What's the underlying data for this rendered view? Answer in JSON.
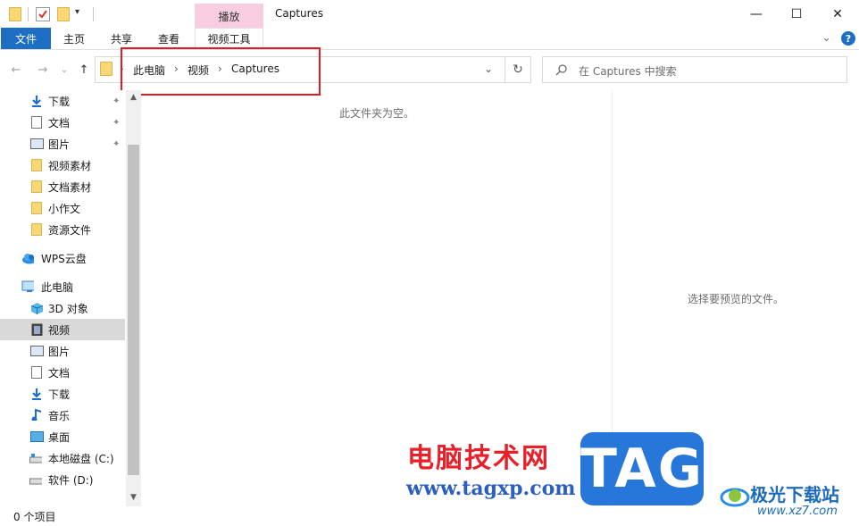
{
  "window": {
    "title": "Captures",
    "contextual_group": "播放",
    "controls": {
      "minimize": "—",
      "maximize": "☐",
      "close": "✕"
    }
  },
  "ribbon": {
    "tabs": [
      {
        "label": "文件"
      },
      {
        "label": "主页"
      },
      {
        "label": "共享"
      },
      {
        "label": "查看"
      },
      {
        "label": "视频工具"
      }
    ],
    "collapse_glyph": "⌄",
    "help_glyph": "?"
  },
  "navigation": {
    "back": "←",
    "forward": "→",
    "recent": "⌄",
    "up": "↑",
    "breadcrumbs": [
      "此电脑",
      "视频",
      "Captures"
    ],
    "dropdown": "⌄",
    "refresh": "↻",
    "search_placeholder": "在 Captures 中搜索"
  },
  "sidebar": {
    "quick_access": [
      {
        "label": "下载",
        "icon": "download-icon",
        "pinned": true
      },
      {
        "label": "文档",
        "icon": "document-icon",
        "pinned": true
      },
      {
        "label": "图片",
        "icon": "picture-icon",
        "pinned": true
      },
      {
        "label": "视频素材",
        "icon": "folder-icon",
        "pinned": false
      },
      {
        "label": "文档素材",
        "icon": "folder-icon",
        "pinned": false
      },
      {
        "label": "小作文",
        "icon": "folder-icon",
        "pinned": false
      },
      {
        "label": "资源文件",
        "icon": "folder-icon",
        "pinned": false
      }
    ],
    "wps": {
      "label": "WPS云盘",
      "icon": "cloud-icon"
    },
    "this_pc": {
      "label": "此电脑",
      "icon": "computer-icon"
    },
    "pc_items": [
      {
        "label": "3D 对象",
        "icon": "cube-icon"
      },
      {
        "label": "视频",
        "icon": "video-icon",
        "selected": true
      },
      {
        "label": "图片",
        "icon": "picture-icon"
      },
      {
        "label": "文档",
        "icon": "document-icon"
      },
      {
        "label": "下载",
        "icon": "download-icon"
      },
      {
        "label": "音乐",
        "icon": "music-icon"
      },
      {
        "label": "桌面",
        "icon": "desktop-icon"
      },
      {
        "label": "本地磁盘 (C:)",
        "icon": "drive-icon"
      },
      {
        "label": "软件 (D:)",
        "icon": "drive-icon"
      }
    ],
    "pin_glyph": "📌"
  },
  "content": {
    "empty_message": "此文件夹为空。",
    "preview_message": "选择要预览的文件。"
  },
  "status": {
    "item_count": "0 个项目"
  },
  "watermark": {
    "title": "电脑技术网",
    "url": "www.tagxp.com",
    "tag": "TAG",
    "site_name": "极光下载站",
    "site_url": "www.xz7.com"
  },
  "colors": {
    "accent": "#1e6fc4",
    "contextual_tab": "#f9cde1",
    "highlight": "#e11b22",
    "selected_row": "#d9d9d9"
  }
}
